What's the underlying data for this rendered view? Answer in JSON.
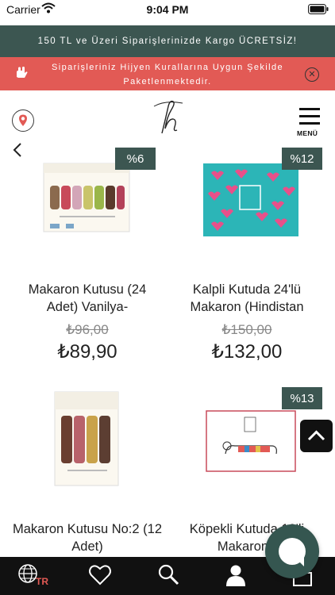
{
  "status_bar": {
    "carrier": "Carrier",
    "time": "9:04 PM"
  },
  "promo_banner": {
    "text": "150 TL ve Üzeri Siparişlerinizde Kargo ÜCRETSİZ!"
  },
  "hygiene_banner": {
    "text": "Siparişleriniz Hijyen Kurallarına Uygun Şekilde Paketlenmektedir.",
    "close_icon": "close-circle-icon"
  },
  "header": {
    "logo_letter": "h",
    "menu_label": "MENÜ",
    "location_icon": "location-pin-icon"
  },
  "products": [
    {
      "badge": "%6",
      "name": "Makaron Kutusu (24 Adet) Vanilya-",
      "old_price": "₺96,00",
      "new_price": "₺89,90",
      "image": "macaron-box-24"
    },
    {
      "badge": "%12",
      "name": "Kalpli Kutuda 24'lü Makaron (Hindistan",
      "old_price": "₺150,00",
      "new_price": "₺132,00",
      "image": "heart-box"
    },
    {
      "badge": "",
      "name": "Makaron Kutusu No:2 (12 Adet)",
      "old_price": "",
      "new_price": "",
      "image": "macaron-box-12"
    },
    {
      "badge": "%13",
      "name": "Köpekli Kutuda 12'li Makaron (",
      "old_price": "",
      "new_price": "",
      "image": "dog-box"
    }
  ],
  "tab_bar": {
    "language": "TR",
    "icons": [
      "globe-icon",
      "heart-icon",
      "search-icon",
      "user-icon",
      "cart-icon"
    ]
  },
  "colors": {
    "brand_green": "#3c5651",
    "alert_red": "#e25a55",
    "tab_bar": "#111111"
  }
}
